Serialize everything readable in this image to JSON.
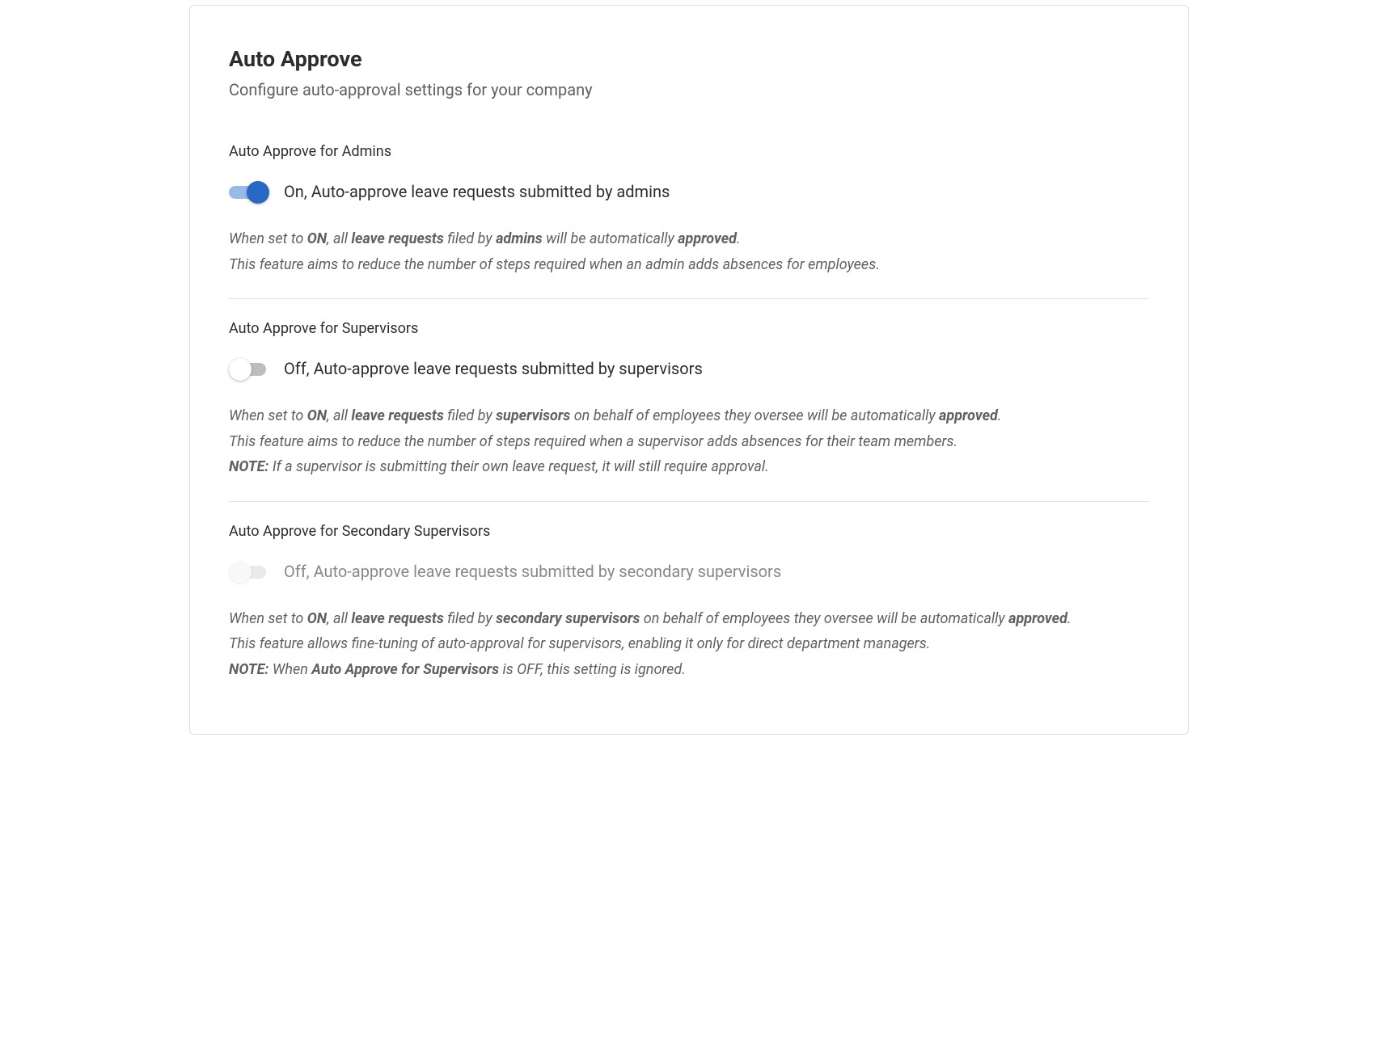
{
  "page": {
    "title": "Auto Approve",
    "subtitle": "Configure auto-approval settings for your company"
  },
  "sections": {
    "admins": {
      "label": "Auto Approve for Admins",
      "toggle_state": "on",
      "toggle_label": "On, Auto-approve leave requests submitted by admins",
      "help_html": "When set to <strong>ON</strong>, all <strong>leave requests</strong> filed by <strong>admins</strong> will be automatically <strong>approved</strong>.<br>This feature aims to reduce the number of steps required when an admin adds absences for employees."
    },
    "supervisors": {
      "label": "Auto Approve for Supervisors",
      "toggle_state": "off",
      "toggle_label": "Off, Auto-approve leave requests submitted by supervisors",
      "help_html": "When set to <strong>ON</strong>, all <strong>leave requests</strong> filed by <strong>supervisors</strong> on behalf of employees they oversee will be automatically <strong>approved</strong>.<br>This feature aims to reduce the number of steps required when a supervisor adds absences for their team members.<br><strong>NOTE:</strong> If a supervisor is submitting their own leave request, it will still require approval."
    },
    "secondary_supervisors": {
      "label": "Auto Approve for Secondary Supervisors",
      "toggle_state": "disabled",
      "toggle_label": "Off, Auto-approve leave requests submitted by secondary supervisors",
      "help_html": "When set to <strong>ON</strong>, all <strong>leave requests</strong> filed by <strong>secondary supervisors</strong> on behalf of employees they oversee will be automatically <strong>approved</strong>.<br>This feature allows fine-tuning of auto-approval for supervisors, enabling it only for direct department managers.<br><strong>NOTE:</strong> When <strong>Auto Approve for Supervisors</strong> is OFF, this setting is ignored."
    }
  }
}
